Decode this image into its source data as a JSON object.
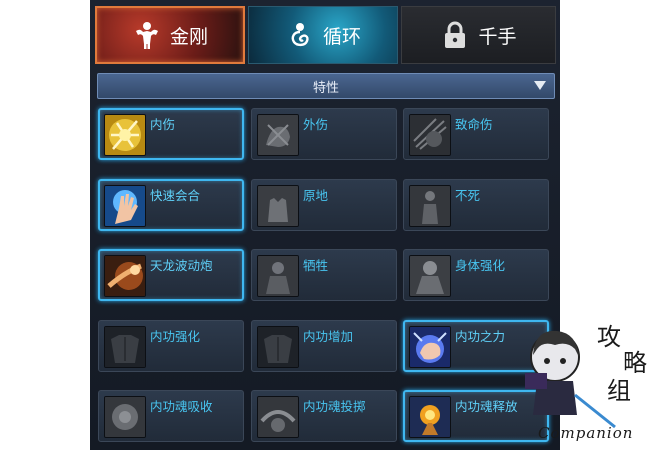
{
  "tabs": [
    {
      "label": "金刚",
      "icon": "muscle-man-icon",
      "selected": true
    },
    {
      "label": "循环",
      "icon": "swirl-figure-icon",
      "selected": false
    },
    {
      "label": "千手",
      "icon": "padlock-icon",
      "selected": false
    }
  ],
  "filter": {
    "label": "特性"
  },
  "skills": [
    {
      "label": "内伤",
      "icon": "golden-fist-icon",
      "selected": true
    },
    {
      "label": "外伤",
      "icon": "grey-fist-icon",
      "selected": false
    },
    {
      "label": "致命伤",
      "icon": "grey-strike-icon",
      "selected": false
    },
    {
      "label": "快速会合",
      "icon": "glowing-hand-icon",
      "selected": true
    },
    {
      "label": "原地",
      "icon": "grey-hand-icon",
      "selected": false
    },
    {
      "label": "不死",
      "icon": "grey-figure-icon",
      "selected": false
    },
    {
      "label": "天龙波动炮",
      "icon": "dragon-blast-icon",
      "selected": true
    },
    {
      "label": "牺牲",
      "icon": "grey-sacrifice-icon",
      "selected": false
    },
    {
      "label": "身体强化",
      "icon": "grey-body-icon",
      "selected": false
    },
    {
      "label": "内功强化",
      "icon": "torso-icon",
      "selected": false
    },
    {
      "label": "内功增加",
      "icon": "torso-icon",
      "selected": false
    },
    {
      "label": "内功之力",
      "icon": "energy-fist-icon",
      "selected": true
    },
    {
      "label": "内功魂吸收",
      "icon": "grey-absorb-icon",
      "selected": false
    },
    {
      "label": "内功魂投掷",
      "icon": "grey-throw-icon",
      "selected": false
    },
    {
      "label": "内功魂释放",
      "icon": "fire-orb-icon",
      "selected": true
    }
  ],
  "watermark": {
    "caption": "Companion",
    "glyphs": "攻略组"
  }
}
